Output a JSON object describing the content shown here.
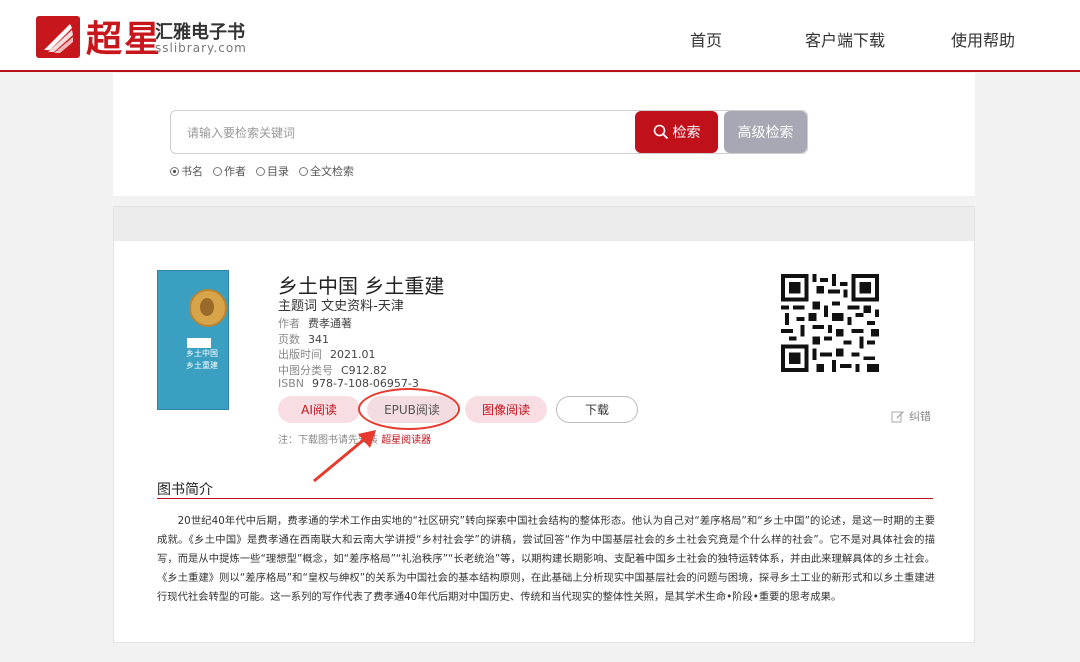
{
  "header": {
    "logo_cn": "超星",
    "brand": "汇雅电子书",
    "domain": "sslibrary.com",
    "nav": [
      "首页",
      "客户端下载",
      "使用帮助"
    ]
  },
  "search": {
    "placeholder": "请输入要检索关键词",
    "search_button": "检索",
    "advanced_button": "高级检索",
    "options": [
      {
        "label": "书名",
        "selected": true
      },
      {
        "label": "作者",
        "selected": false
      },
      {
        "label": "目录",
        "selected": false
      },
      {
        "label": "全文检索",
        "selected": false
      }
    ]
  },
  "book": {
    "title": "乡土中国 乡土重建",
    "subject": "主题词 文史资料-天津",
    "meta": [
      {
        "label": "作者",
        "value": "费孝通著"
      },
      {
        "label": "页数",
        "value": "341"
      },
      {
        "label": "出版时间",
        "value": "2021.01"
      },
      {
        "label": "中图分类号",
        "value": "C912.82"
      },
      {
        "label": "ISBN",
        "value": "978-7-108-06957-3"
      }
    ],
    "cover_title_lines": [
      "乡土中国",
      "乡土重建"
    ],
    "buttons": {
      "ai": "AI阅读",
      "epub": "EPUB阅读",
      "image": "图像阅读",
      "download": "下载"
    },
    "note_prefix": "注：下载图书请先安装",
    "note_link": "超星阅读器",
    "report_label": "纠错"
  },
  "intro": {
    "heading": "图书简介",
    "text": "20世纪40年代中后期，费孝通的学术工作由实地的“社区研究”转向探索中国社会结构的整体形态。他认为自己对“差序格局”和“乡土中国”的论述，是这一时期的主要成就。《乡土中国》是费孝通在西南联大和云南大学讲授“乡村社会学”的讲稿，尝试回答“作为中国基层社会的乡土社会究竟是个什么样的社会”。它不是对具体社会的描写，而是从中提炼一些“理想型”概念，如“差序格局”“礼治秩序”“长老统治”等，以期构建长期影响、支配着中国乡土社会的独特运转体系，并由此来理解具体的乡土社会。《乡土重建》则以“差序格局”和“皇权与绅权”的关系为中国社会的基本结构原则，在此基础上分析现实中国基层社会的问题与困境，探寻乡土工业的新形式和以乡土重建进行现代社会转型的可能。这一系列的写作代表了费孝通40年代后期对中国历史、传统和当代现实的整体性关照，是其学术生命•阶段•重要的思考成果。"
  },
  "colors": {
    "accent": "#c0111b",
    "secondary_button": "#a7a8b3",
    "annotation": "#e63a2e"
  }
}
